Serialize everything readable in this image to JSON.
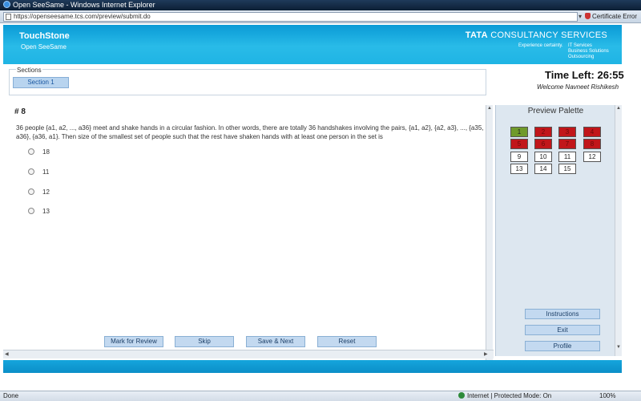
{
  "window": {
    "title": "Open SeeSame - Windows Internet Explorer",
    "url": "https://openseesame.tcs.com/preview/submit.do",
    "cert_error": "Certificate Error"
  },
  "banner": {
    "brand": "TouchStone",
    "brand_sub": "Open SeeSame",
    "company_bold": "TATA",
    "company_rest": " CONSULTANCY SERVICES",
    "tagline": "Experience certainty.",
    "tag_items": [
      "IT Services",
      "Business Solutions",
      "Outsourcing"
    ]
  },
  "sections": {
    "label": "Sections",
    "active": "Section 1"
  },
  "timer": {
    "text": "Time Left: 26:55"
  },
  "welcome": "Welcome Navneet Rishikesh",
  "question": {
    "number": "# 8",
    "text": "36 people {a1, a2, ..., a36} meet and shake hands in a circular fashion. In other words, there are totally 36 handshakes involving the pairs, {a1, a2}, {a2, a3}, ..., {a35, a36}, {a36, a1}. Then size of the smallest set of people such that the rest have shaken hands with at least one person in the set is",
    "options": [
      "18",
      "11",
      "12",
      "13"
    ]
  },
  "actions": {
    "mark": "Mark for Review",
    "skip": "Skip",
    "save": "Save & Next",
    "reset": "Reset"
  },
  "palette": {
    "title": "Preview Palette",
    "items": [
      {
        "label": "1",
        "status": "answered-green"
      },
      {
        "label": "2",
        "status": "red"
      },
      {
        "label": "3",
        "status": "red"
      },
      {
        "label": "4",
        "status": "red"
      },
      {
        "label": "5",
        "status": "red"
      },
      {
        "label": "6",
        "status": "red"
      },
      {
        "label": "7",
        "status": "red"
      },
      {
        "label": "8",
        "status": "red"
      },
      {
        "label": "9",
        "status": "white"
      },
      {
        "label": "10",
        "status": "white"
      },
      {
        "label": "11",
        "status": "white"
      },
      {
        "label": "12",
        "status": "white"
      },
      {
        "label": "13",
        "status": "white"
      },
      {
        "label": "14",
        "status": "white"
      },
      {
        "label": "15",
        "status": "white"
      }
    ],
    "instructions": "Instructions",
    "exit": "Exit",
    "profile": "Profile"
  },
  "statusbar": {
    "left": "Done",
    "zone": "Internet | Protected Mode: On",
    "zoom": "100%"
  },
  "colors": {
    "banner": "#1fb4e4",
    "answered": "#6f9a2b",
    "not_answered": "#c1161a",
    "button": "#c3d9f0"
  }
}
